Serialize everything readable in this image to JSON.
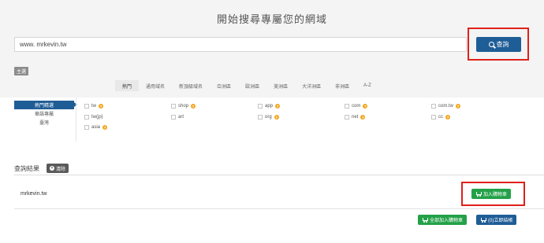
{
  "page": {
    "title": "開始搜尋專屬您的網域"
  },
  "search": {
    "value": "www. mrkevin.tw",
    "button_label": "查詢"
  },
  "section_badge": "主選",
  "tabs": [
    "熱門",
    "通用域名",
    "新頂級域名",
    "亞洲區",
    "歐洲區",
    "美洲區",
    "大洋洲區",
    "非洲區",
    "A-Z"
  ],
  "sidebar": {
    "items": [
      "熱門精選",
      "華語專屬",
      "臺灣"
    ]
  },
  "options": [
    {
      "label": "tw",
      "help": "?"
    },
    {
      "label": "shop",
      "help": "?"
    },
    {
      "label": "app",
      "help": "?"
    },
    {
      "label": "com",
      "help": "?"
    },
    {
      "label": "com.tw",
      "help": "?"
    },
    {
      "label": "tw(jp)",
      "help": ""
    },
    {
      "label": "art",
      "help": ""
    },
    {
      "label": "org",
      "help": "?"
    },
    {
      "label": "net",
      "help": "?"
    },
    {
      "label": "cc",
      "help": "?"
    },
    {
      "label": "asia",
      "help": "?"
    }
  ],
  "results": {
    "label": "查詢結果",
    "clear_label": "清除",
    "rows": [
      {
        "domain": "mrkevin.tw",
        "add_label": "加入購物車"
      }
    ],
    "add_all_label": "全部加入購物車",
    "checkout_label": "(0)立即結帳"
  },
  "colors": {
    "primary": "#1f5d96",
    "success": "#24a148",
    "highlight": "#e0201a",
    "help": "#f3a61c"
  }
}
